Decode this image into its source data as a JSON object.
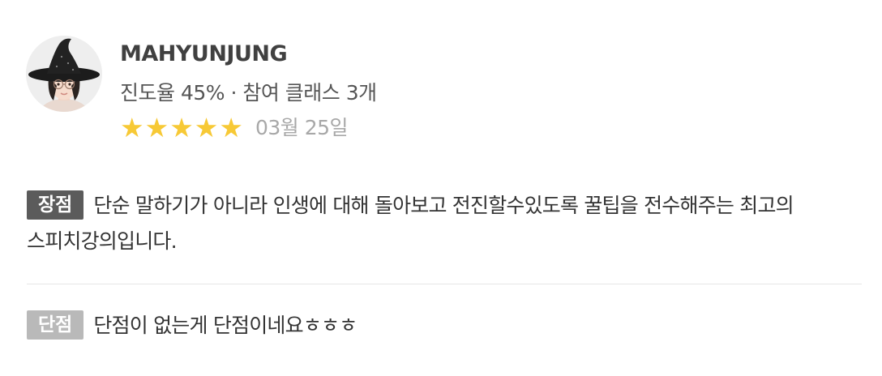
{
  "review": {
    "user_name": "MAHYUNJUNG",
    "meta": "진도율 45% · 참여 클래스 3개",
    "rating": 5,
    "rating_max": 5,
    "star_color": "#f7c936",
    "date": "03월 25일",
    "pros": {
      "tag": "장점",
      "text": "단순 말하기가 아니라 인생에 대해 돌아보고 전진할수있도록  꿀팁을 전수해주는 최고의 스피치강의입니다."
    },
    "cons": {
      "tag": "단점",
      "text": "단점이 없는게 단점이네요ㅎㅎㅎ"
    }
  },
  "colors": {
    "pros_tag_bg": "#5b5b5b",
    "cons_tag_bg": "#b9b9b9",
    "text": "#333333",
    "date": "#a8a8a8"
  },
  "icons": {
    "avatar": "user-avatar-witch-hat",
    "star": "star-icon"
  }
}
